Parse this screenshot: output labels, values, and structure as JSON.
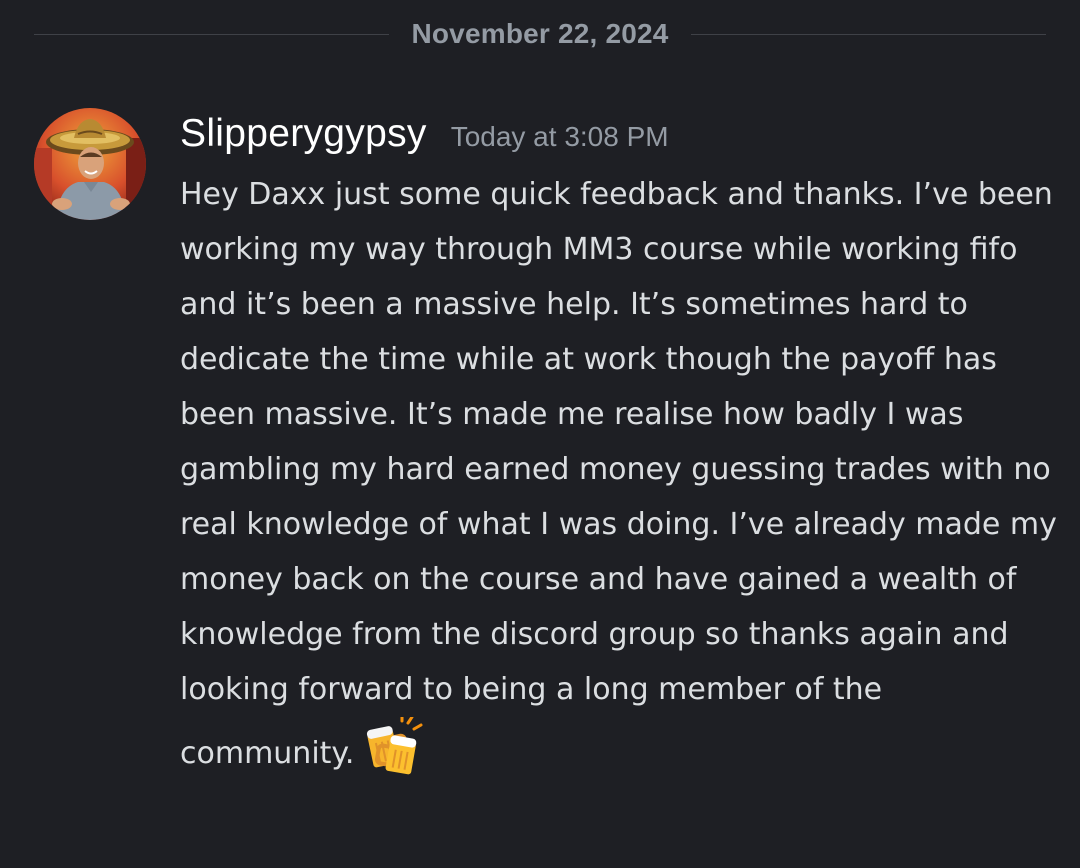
{
  "divider": {
    "date": "November 22, 2024"
  },
  "message": {
    "username": "Slipperygypsy",
    "timestamp": "Today at 3:08 PM",
    "text": "Hey Daxx just some quick feedback and thanks. I’ve been working my way through MM3 course while working fifo and it’s been a massive help. It’s sometimes hard to dedicate the time while at work though the payoff has been massive. It’s made me realise how badly I was gambling my hard earned money guessing trades with no real knowledge of what I was doing. I’ve already made my money back on the course and have gained a wealth of knowledge from the discord group so thanks again and looking forward to being a long member of the community.",
    "emoji": "clinking-beer-mugs-icon"
  },
  "colors": {
    "background": "#1e1f24",
    "username": "#ffffff",
    "timestamp": "#949ba4",
    "message_text": "#dbdee1",
    "divider_line": "#3f4147"
  }
}
